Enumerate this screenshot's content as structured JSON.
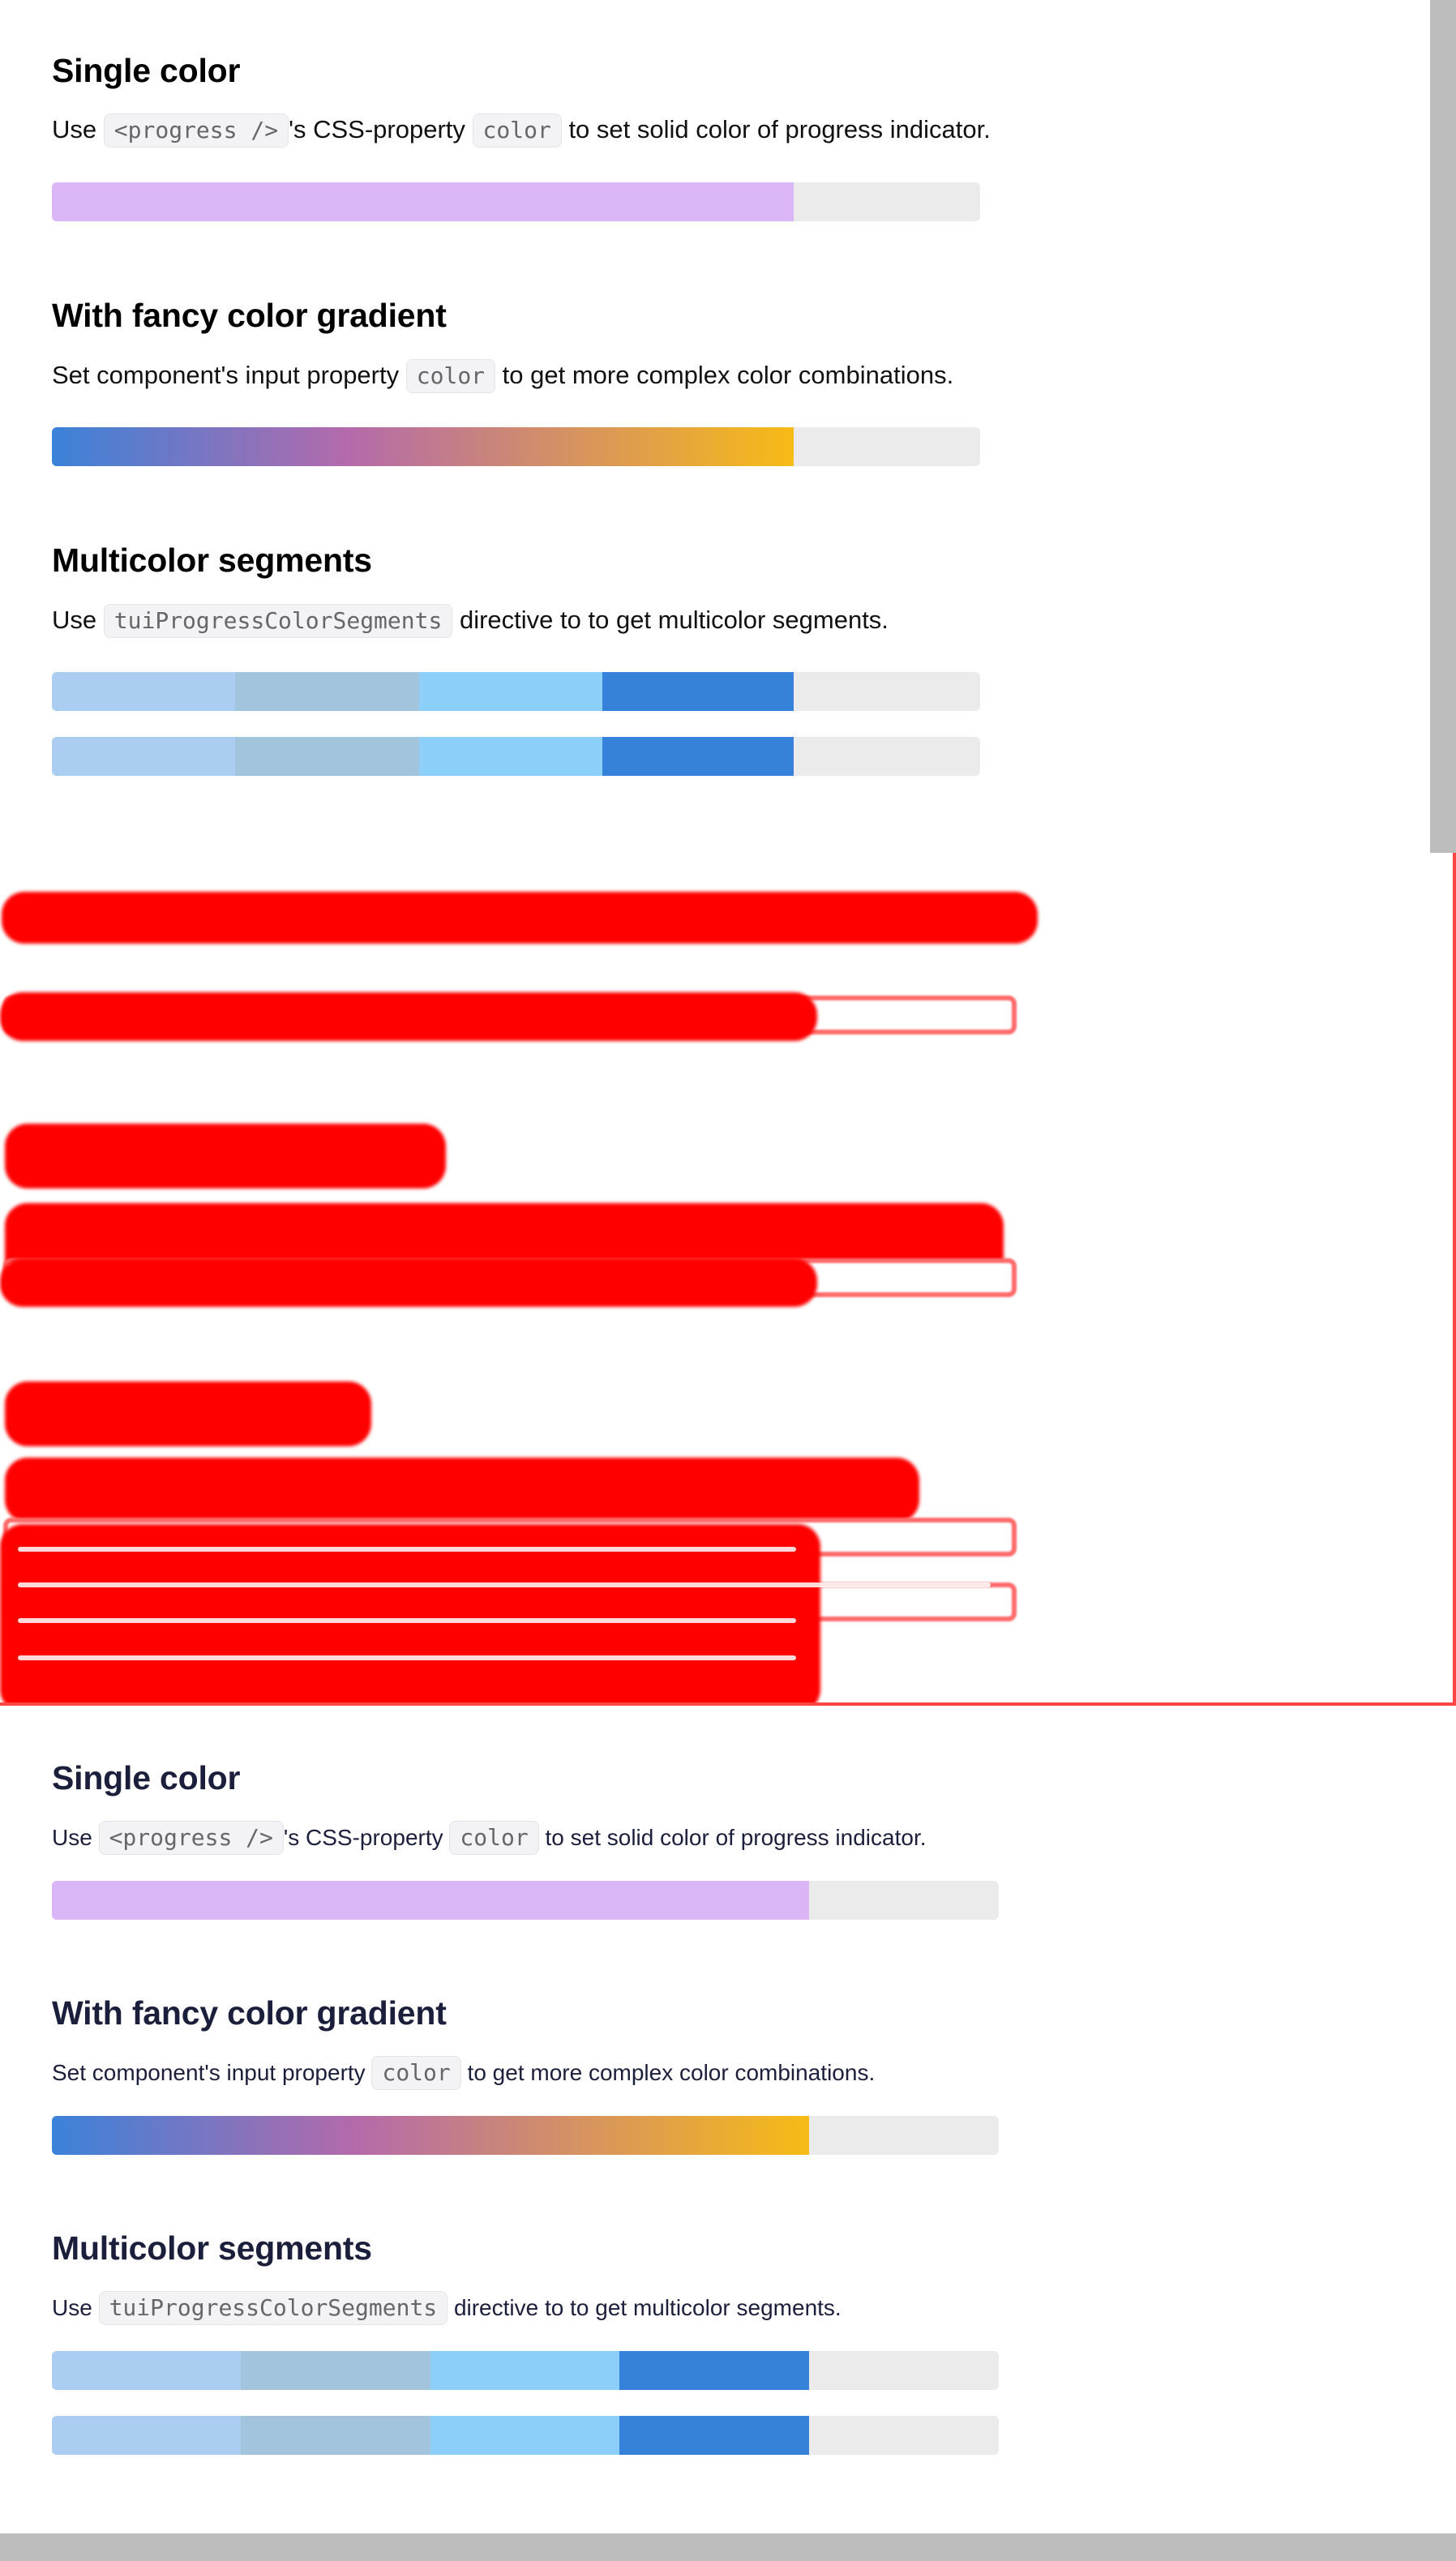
{
  "sections": {
    "single": {
      "title": "Single color",
      "desc_pre": "Use",
      "code1": "<progress />",
      "desc_mid": "'s CSS-property",
      "code2": "color",
      "desc_post": "to set solid color of progress indicator.",
      "value": 0.8,
      "color": "#dab6f7"
    },
    "gradient": {
      "title": "With fancy color gradient",
      "desc_pre": "Set component's input property",
      "code": "color",
      "desc_post": "to get more complex color combinations.",
      "value": 0.8,
      "colors": [
        "#3b82d9",
        "#b46aab",
        "#f7bb16"
      ]
    },
    "segments": {
      "title": "Multicolor segments",
      "desc_pre": "Use",
      "code": "tuiProgressColorSegments",
      "desc_post": "directive to to get multicolor segments.",
      "value": 0.8,
      "segment_colors": [
        "#aacdf1",
        "#a2c4dd",
        "#8ccff9",
        "#3681d9"
      ]
    }
  },
  "track_color": "#ebebeb"
}
